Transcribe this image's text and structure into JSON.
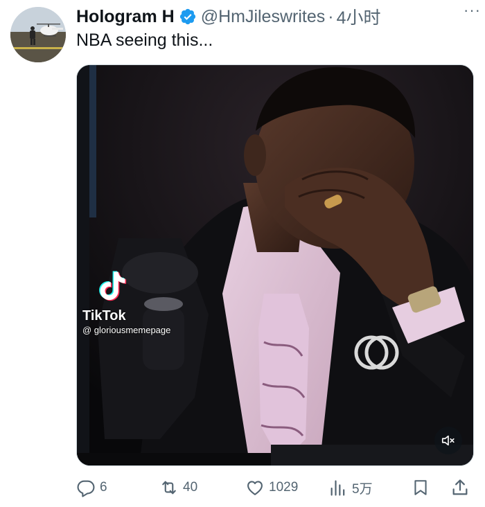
{
  "tweet": {
    "author_name": "Hologram H",
    "handle": "@HmJileswrites",
    "separator": "·",
    "time": "4小时",
    "text": "NBA seeing this...",
    "more_label": "···"
  },
  "media": {
    "watermark_brand": "TikTok",
    "watermark_user": "@ gloriousmemepage"
  },
  "actions": {
    "replies": "6",
    "retweets": "40",
    "likes": "1029",
    "views": "5万"
  },
  "colors": {
    "verified": "#1d9bf0",
    "text": "#0f1419",
    "muted": "#536471"
  }
}
